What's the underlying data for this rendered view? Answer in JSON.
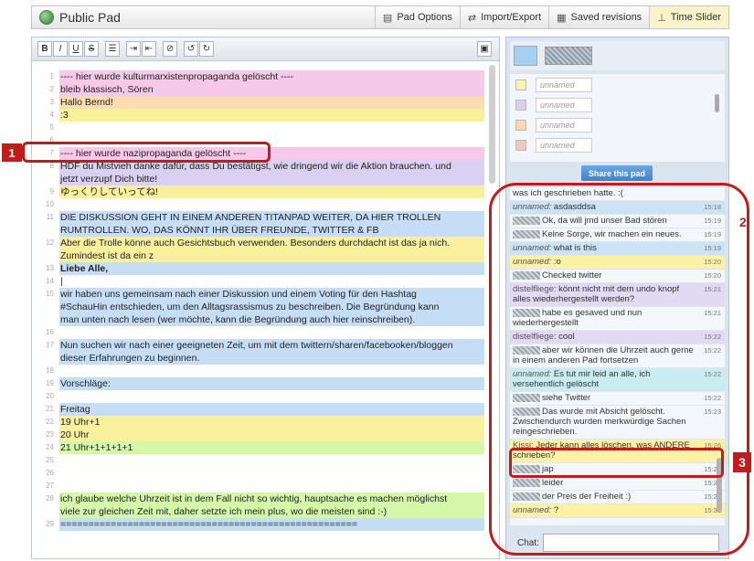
{
  "header": {
    "pad_title": "Public Pad",
    "buttons": [
      {
        "icon": "file-icon",
        "glyph": "▤",
        "label": "Pad Options"
      },
      {
        "icon": "import-export-icon",
        "glyph": "⇄",
        "label": "Import/Export"
      },
      {
        "icon": "saved-revisions-icon",
        "glyph": "▦",
        "label": "Saved revisions"
      },
      {
        "icon": "time-slider-icon",
        "glyph": "⊥",
        "label": "Time Slider"
      }
    ]
  },
  "toolbar": {
    "bold": "B",
    "italic": "I",
    "underline": "U",
    "strike": "S",
    "list": "☰",
    "indent": "⇥",
    "outdent": "⇤",
    "clear": "⊘",
    "undo": "↺",
    "redo": "↻",
    "save": "▣"
  },
  "editor": {
    "lines": [
      {
        "n": "1",
        "text": "---- hier wurde kulturmarxistenpropaganda gelöscht ----",
        "color": "pink"
      },
      {
        "n": "2",
        "text": "bleib klassisch, Sören",
        "color": "pink"
      },
      {
        "n": "3",
        "text": "Hallo Bernd!",
        "color": "orange"
      },
      {
        "n": "4",
        "text": ":3",
        "color": "yellow"
      },
      {
        "n": "5",
        "text": "",
        "color": "white"
      },
      {
        "n": "6",
        "text": "",
        "color": "white"
      },
      {
        "n": "7",
        "text": "---- hier wurde nazipropaganda gelöscht ----",
        "color": "pink"
      },
      {
        "n": "8",
        "text": "HDF du Mistvieh danke dafür, dass Du bestätigst, wie dringend wir die Aktion brauchen. und",
        "color": "purple"
      },
      {
        "n": "",
        "text": "jetzt verzupf Dich bitte!",
        "color": "purple"
      },
      {
        "n": "9",
        "text": "ゆっくりしていってね!",
        "color": "yellow"
      },
      {
        "n": "10",
        "text": "",
        "color": "white"
      },
      {
        "n": "11",
        "text": "DIE DISKUSSION GEHT IN EINEM ANDEREN TITANPAD WEITER, DA HIER TROLLEN",
        "color": "blue"
      },
      {
        "n": "",
        "text": "RUMTROLLEN. WO, DAS KÖNNT IHR ÜBER FREUNDE, TWITTER & FB",
        "color": "blue"
      },
      {
        "n": "12",
        "text": "Aber die Trolle könne auch Gesichtsbuch verwenden. Besonders durchdacht ist das ja nich.",
        "color": "yellow"
      },
      {
        "n": "",
        "text": "Zumindest ist da ein z",
        "color": "yellow"
      },
      {
        "n": "13",
        "text": "Liebe Alle,",
        "color": "blue",
        "bold": true
      },
      {
        "n": "14",
        "text": "|",
        "color": "white"
      },
      {
        "n": "15",
        "text": "wir haben uns gemeinsam nach einer Diskussion und einem Voting für den Hashtag",
        "color": "blue"
      },
      {
        "n": "",
        "text": "#SchauHin entschieden, um den Alltagsrassismus zu beschreiben. Die Begründung kann",
        "color": "blue"
      },
      {
        "n": "",
        "text": "man unten nach lesen (wer möchte, kann die Begründung auch hier reinschreiben).",
        "color": "blue"
      },
      {
        "n": "16",
        "text": "",
        "color": "white"
      },
      {
        "n": "17",
        "text": "Nun suchen wir nach einer geeigneten Zeit, um mit dem twittern/sharen/facebooken/bloggen",
        "color": "blue"
      },
      {
        "n": "",
        "text": "dieser Erfahrungen zu beginnen.",
        "color": "blue"
      },
      {
        "n": "18",
        "text": "",
        "color": "white"
      },
      {
        "n": "19",
        "text": "Vorschläge:",
        "color": "blue"
      },
      {
        "n": "20",
        "text": "",
        "color": "white"
      },
      {
        "n": "21",
        "text": "Freitag",
        "color": "blue"
      },
      {
        "n": "22",
        "text": "19 Uhr+1",
        "color": "yellow"
      },
      {
        "n": "23",
        "text": "20 Uhr",
        "color": "yellow"
      },
      {
        "n": "24",
        "text": "21 Uhr+1+1+1+1",
        "color": "green"
      },
      {
        "n": "25",
        "text": "",
        "color": "white"
      },
      {
        "n": "26",
        "text": "",
        "color": "white"
      },
      {
        "n": "27",
        "text": "",
        "color": "white"
      },
      {
        "n": "28",
        "text": "ich glaube welche Uhrzeit ist in dem Fall nicht so wichtig, hauptsache es machen möglichst",
        "color": "green"
      },
      {
        "n": "",
        "text": "viele zur gleichen Zeit mit, daher setzte ich mein plus, wo die meisten sind :-)",
        "color": "green"
      },
      {
        "n": "29",
        "text": "=====================================================",
        "color": "blue"
      }
    ]
  },
  "annotations": {
    "one": "1",
    "two": "2",
    "three": "3"
  },
  "sidebar": {
    "users": [
      {
        "name": "unnamed",
        "color": "#f7f3b0"
      },
      {
        "name": "unnamed",
        "color": "#d8cff2"
      },
      {
        "name": "unnamed",
        "color": "#f9d8b0"
      },
      {
        "name": "unnamed",
        "color": "#f6c6bd"
      }
    ],
    "share_label": "Share this pad",
    "chat_label": "Chat:",
    "chat": [
      {
        "author": "",
        "avatar": false,
        "text": "was ich geschrieben hatte. :(",
        "time": "",
        "color": "white"
      },
      {
        "author": "unnamed:",
        "avatar": false,
        "text": "asdasddsa",
        "time": "15:18",
        "color": "blue"
      },
      {
        "author": "",
        "avatar": true,
        "text": "Ok, da will jmd unser Bad stören",
        "time": "15:19",
        "color": "white"
      },
      {
        "author": "",
        "avatar": true,
        "text": "Keine Sorge, wir machen ein neues.",
        "time": "15:19",
        "color": "white"
      },
      {
        "author": "unnamed:",
        "avatar": false,
        "text": "what is this",
        "time": "15:19",
        "color": "blue"
      },
      {
        "author": "unnamed:",
        "avatar": false,
        "text": ":o",
        "time": "15:20",
        "color": "yellow"
      },
      {
        "author": "",
        "avatar": true,
        "text": "Checked twitter",
        "time": "15:20",
        "color": "white"
      },
      {
        "author": "distelfliege:",
        "avatar": false,
        "text": "könnt nicht mit dem undo knopf alles wiederhergestellt werden?",
        "time": "15:21",
        "color": "purple"
      },
      {
        "author": "",
        "avatar": true,
        "text": "habe es gesaved und nun wiederhergestellt",
        "time": "15:21",
        "color": "white"
      },
      {
        "author": "distelfliege:",
        "avatar": false,
        "text": "cool",
        "time": "15:22",
        "color": "purple"
      },
      {
        "author": "",
        "avatar": true,
        "text": "aber wir können die Uhrzeit auch gerne in einem anderen Pad fortsetzen",
        "time": "15:22",
        "color": "white"
      },
      {
        "author": "unnamed:",
        "avatar": false,
        "text": "Es tut mir leid an alle, ich versehentlich gelöscht",
        "time": "15:22",
        "color": "cyan"
      },
      {
        "author": "",
        "avatar": true,
        "text": "siehe Twitter",
        "time": "15:22",
        "color": "white"
      },
      {
        "author": "",
        "avatar": true,
        "text": "Das wurde mit Absicht gelöscht. Zwischendurch wurden merkwürdige Sachen reingeschrieben.",
        "time": "15:23",
        "color": "white"
      },
      {
        "author": "Kissi:",
        "avatar": false,
        "text": "Jeder kann alles löschen, was ANDERE schrieben?",
        "time": "15:26",
        "color": "yellow"
      },
      {
        "author": "",
        "avatar": true,
        "text": "jap",
        "time": "15:27",
        "color": "white"
      },
      {
        "author": "",
        "avatar": true,
        "text": "leider",
        "time": "15:27",
        "color": "white"
      },
      {
        "author": "",
        "avatar": true,
        "text": "der Preis der Freiheit :)",
        "time": "15:28",
        "color": "white"
      },
      {
        "author": "unnamed:",
        "avatar": false,
        "text": "?",
        "time": "15:31",
        "color": "yellow"
      }
    ]
  }
}
